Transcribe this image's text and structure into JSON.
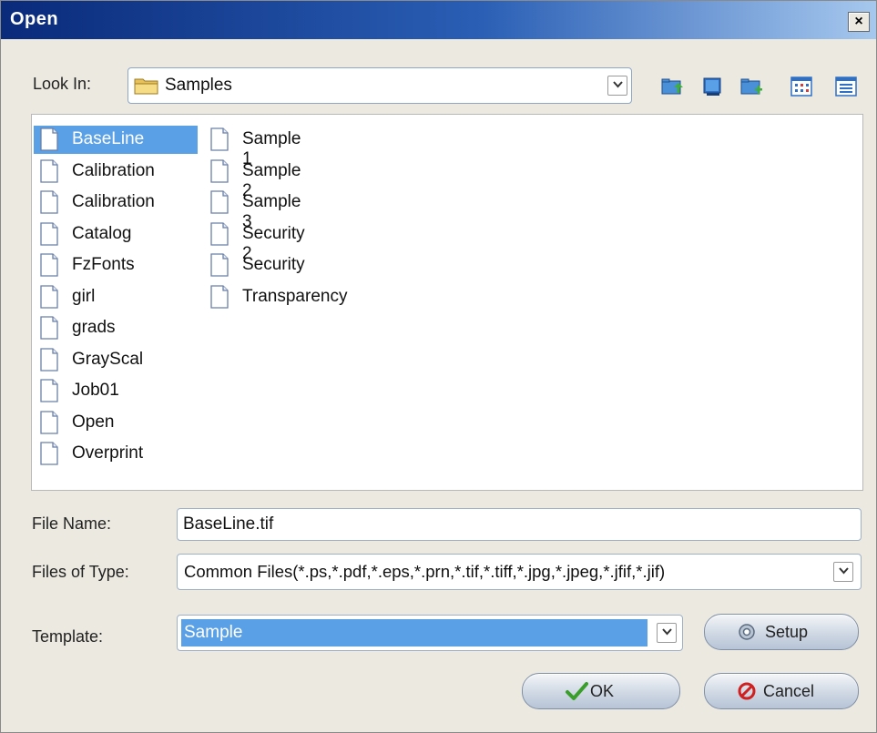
{
  "window": {
    "title": "Open",
    "close_glyph": "×"
  },
  "look_in": {
    "label": "Look In:",
    "value": "Samples"
  },
  "toolbar": [
    "up-folder-icon",
    "desktop-icon",
    "new-folder-icon",
    "list-view-icon",
    "details-view-icon"
  ],
  "files": {
    "column1": [
      "BaseLine",
      "Calibration",
      "Calibration",
      "Catalog",
      "FzFonts",
      "girl",
      "grads",
      "GrayScal",
      "Job01",
      "Open",
      "Overprint"
    ],
    "column2": [
      "Sample 1",
      "Sample 2",
      "Sample 3",
      "Security 2",
      "Security",
      "Transparency"
    ],
    "selected": "BaseLine"
  },
  "file_name": {
    "label": "File Name:",
    "value": "BaseLine.tif"
  },
  "files_of_type": {
    "label": "Files of Type:",
    "value": "Common Files(*.ps,*.pdf,*.eps,*.prn,*.tif,*.tiff,*.jpg,*.jpeg,*.jfif,*.jif)"
  },
  "template": {
    "label": "Template:",
    "value": "Sample"
  },
  "buttons": {
    "setup": "Setup",
    "ok": "OK",
    "cancel": "Cancel"
  },
  "colors": {
    "selection": "#5aa0e6",
    "title_bar": "#0a2a7a",
    "dialog_bg": "#ece9e1"
  }
}
